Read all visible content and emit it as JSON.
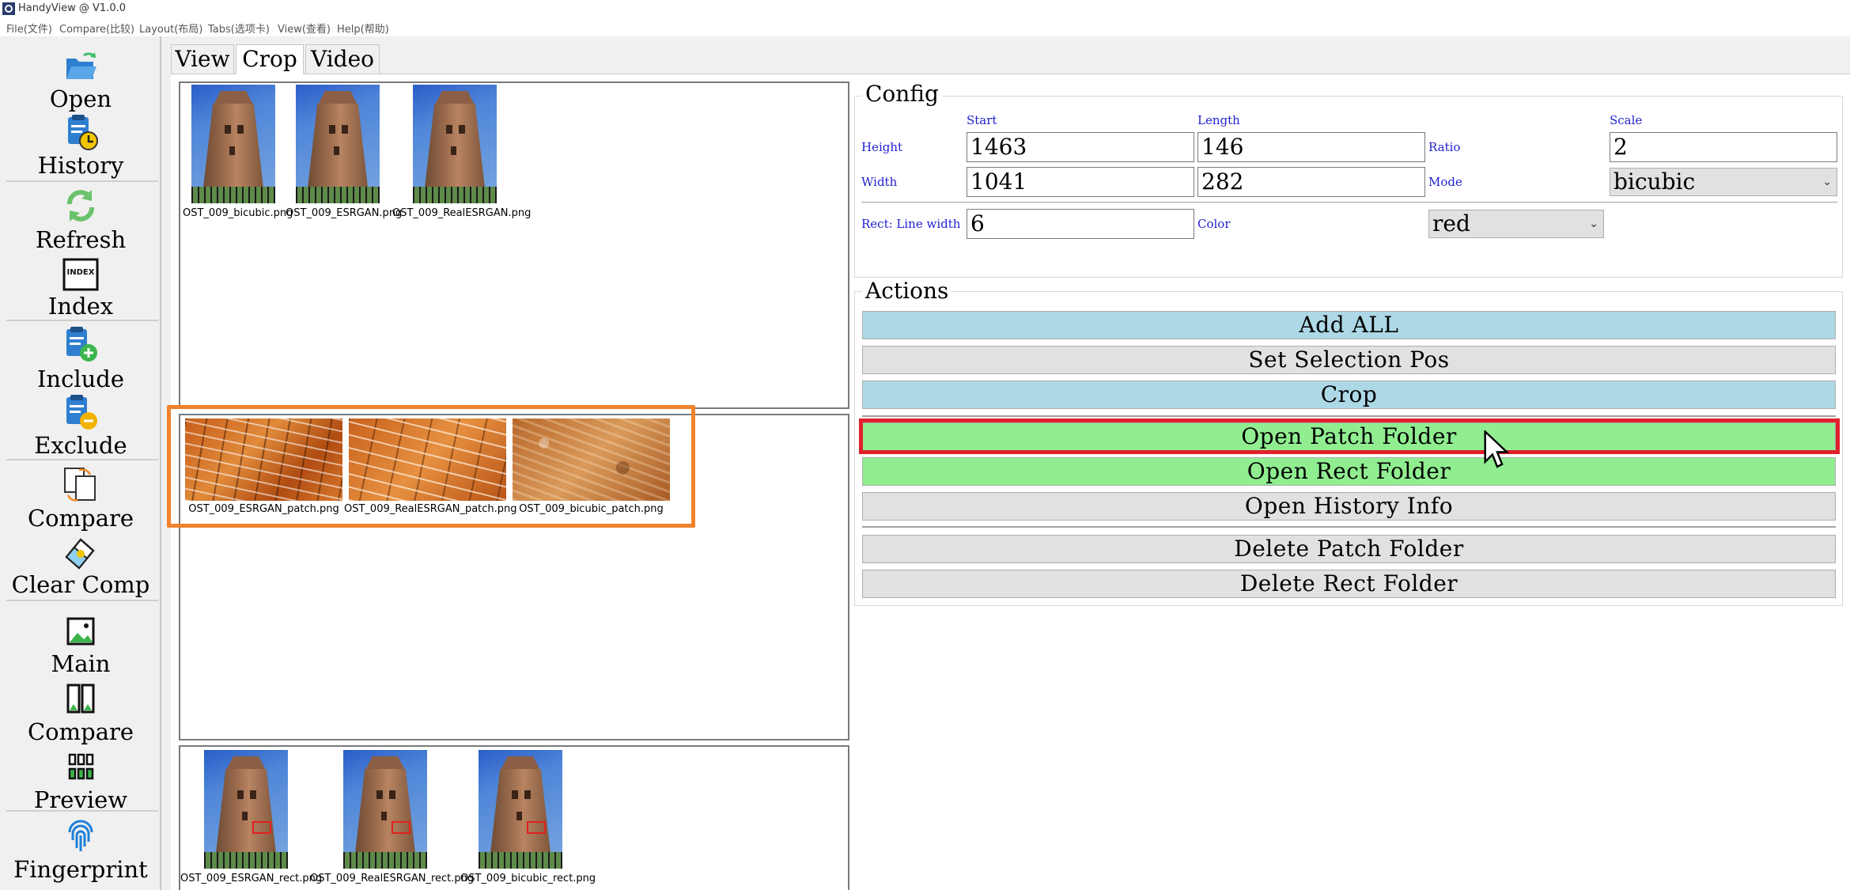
{
  "window": {
    "title": "HandyView @ V1.0.0"
  },
  "menu": [
    "File(文件)",
    "Compare(比较)",
    "Layout(布局)",
    "Tabs(选项卡)",
    "View(查看)",
    "Help(帮助)"
  ],
  "sidebar": {
    "open": "Open",
    "history": "History",
    "refresh": "Refresh",
    "index": "Index",
    "include": "Include",
    "exclude": "Exclude",
    "compare": "Compare",
    "clear_comp": "Clear Comp",
    "main": "Main",
    "compare2": "Compare",
    "preview": "Preview",
    "fingerprint": "Fingerprint",
    "index_icon_text": "INDEX"
  },
  "tabs": [
    "View",
    "Crop",
    "Video"
  ],
  "images": {
    "originals": [
      "OST_009_bicubic.png",
      "OST_009_ESRGAN.png",
      "OST_009_RealESRGAN.png"
    ],
    "patches": [
      "OST_009_ESRGAN_patch.png",
      "OST_009_RealESRGAN_patch.png",
      "OST_009_bicubic_patch.png"
    ],
    "rects": [
      "OST_009_ESRGAN_rect.png",
      "OST_009_RealESRGAN_rect.png",
      "OST_009_bicubic_rect.png"
    ]
  },
  "config": {
    "title": "Config",
    "col_start": "Start",
    "col_length": "Length",
    "col_scale": "Scale",
    "height_label": "Height",
    "width_label": "Width",
    "ratio_label": "Ratio",
    "mode_label": "Mode",
    "height_start": "1463",
    "height_length": "146",
    "width_start": "1041",
    "width_length": "282",
    "scale": "2",
    "mode": "bicubic",
    "rect_line_label": "Rect: Line width",
    "rect_line_width": "6",
    "color_label": "Color",
    "color": "red"
  },
  "actions": {
    "title": "Actions",
    "add_all": "Add ALL",
    "set_selection_pos": "Set Selection Pos",
    "crop": "Crop",
    "open_patch_folder": "Open Patch Folder",
    "open_rect_folder": "Open Rect Folder",
    "open_history_info": "Open History Info",
    "delete_patch_folder": "Delete Patch Folder",
    "delete_rect_folder": "Delete Rect Folder"
  },
  "colors": {
    "highlight_red": "#e0202a",
    "highlight_orange": "#f0822c",
    "btn_blue": "#add8e6",
    "btn_green": "#90ee90"
  }
}
